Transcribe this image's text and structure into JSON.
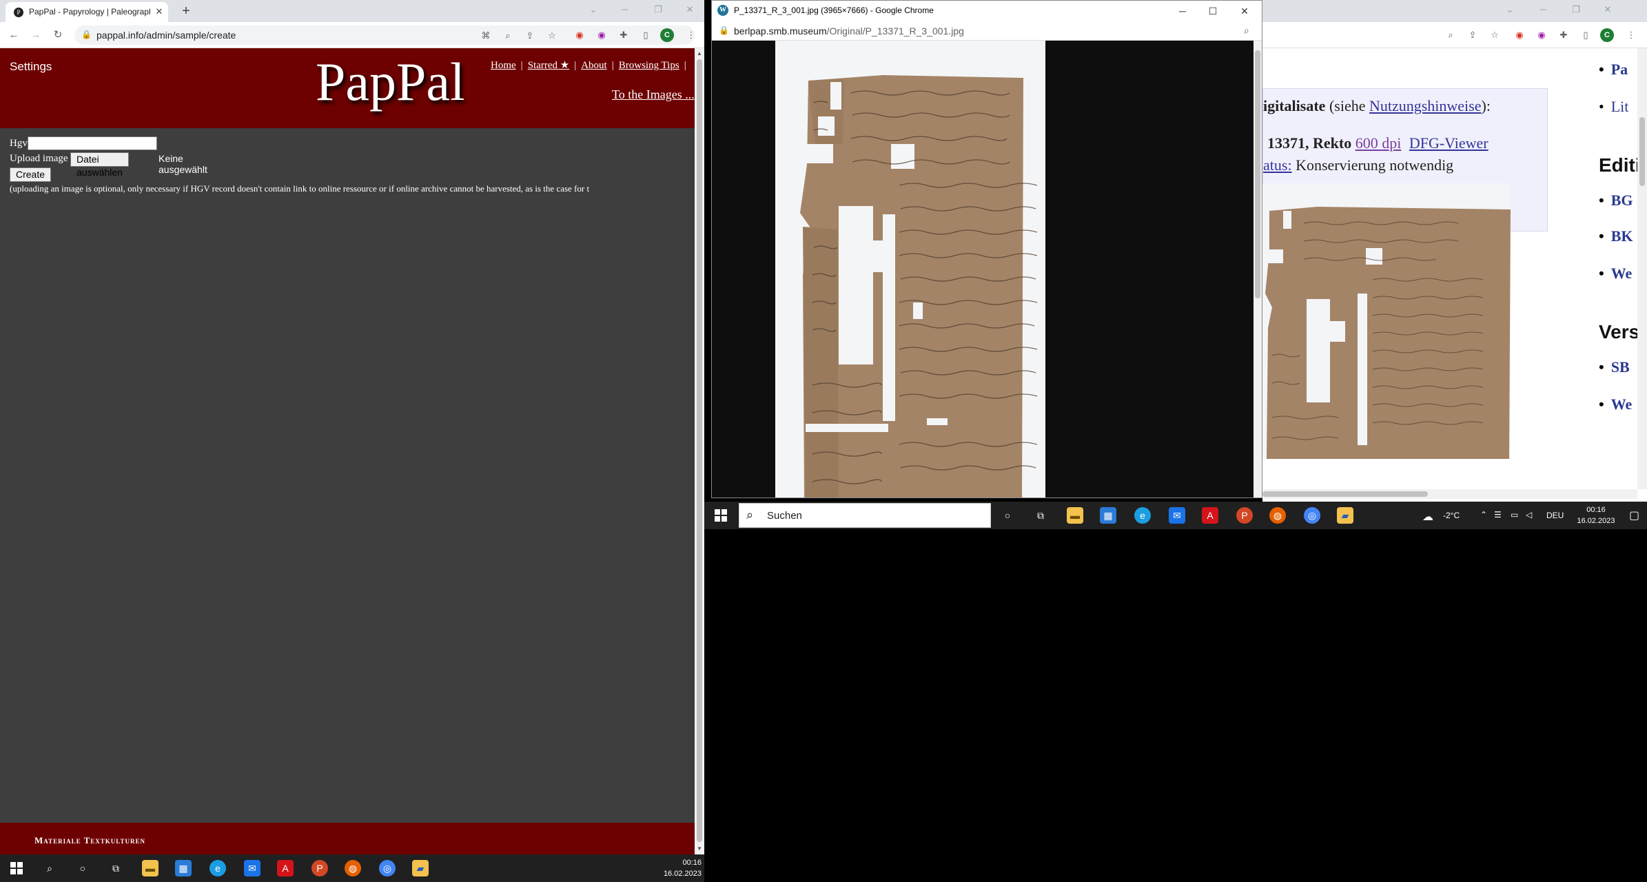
{
  "left_browser": {
    "tab_title": "PapPal - Papyrology | Paleograph",
    "tab_favicon": "P",
    "tab_close": "✕",
    "new_tab": "+",
    "url": "pappal.info/admin/sample/create",
    "avatar": "C"
  },
  "pappal": {
    "settings": "Settings",
    "logo": "PapPal",
    "nav": [
      "Home",
      "Starred ★",
      "About",
      "Browsing Tips"
    ],
    "nav_sep": "|",
    "to_images": "To the Images ...",
    "hgv_label": "Hgv",
    "upload_label": "Upload image",
    "file_button": "Datei auswählen",
    "file_status": "Keine ausgewählt",
    "create_button": "Create",
    "note": "(uploading an image is optional, only necessary if HGV record doesn't contain link to online ressource or if online archive cannot be harvested, as is the case for t",
    "footer": "Materiale Textkulturen"
  },
  "left_taskbar": {
    "time": "00:16",
    "date": "16.02.2023"
  },
  "popup": {
    "title": "P_13371_R_3_001.jpg (3965×7666) - Google Chrome",
    "favicon": "W",
    "url_host": "berlpap.smb.museum",
    "url_path": "/Original/P_13371_R_3_001.jpg"
  },
  "right_browser": {
    "avatar": "C",
    "list_top": [
      "Pa",
      "Lit"
    ],
    "digitalisate_bold": "igitalisate",
    "digitalisate_rest": " (siehe ",
    "nutzungshinweise": "Nutzungshinweise",
    "digitalisate_end": "):",
    "rekto_bold": "13371, Rekto",
    "dpi_link": "600 dpi",
    "dfg_link": "DFG-Viewer",
    "status_link": "atus:",
    "status_text": " Konservierung notwendig",
    "editions_heading": "Editi",
    "editions": [
      "BG",
      "BK",
      "We"
    ],
    "versions_heading": "Vers",
    "versions": [
      "SB",
      "We"
    ]
  },
  "right_taskbar": {
    "search": "Suchen",
    "weather": "-2°C",
    "language": "DEU",
    "time": "00:16",
    "date": "16.02.2023"
  },
  "colors": {
    "pappal_red": "#6d0000",
    "page_gray": "#3e3e3e",
    "papyrus": "#a48466",
    "link_blue": "#333399"
  }
}
